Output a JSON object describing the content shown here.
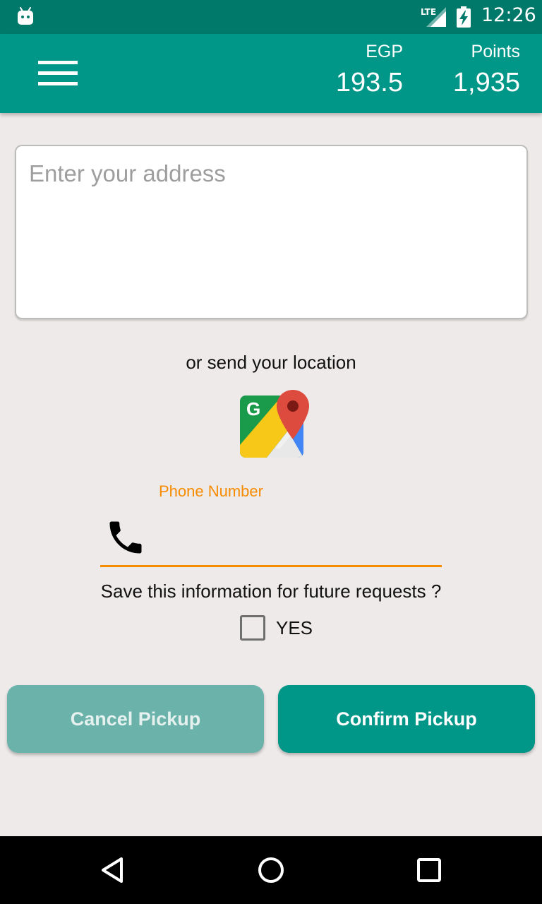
{
  "status_bar": {
    "time": "12:26",
    "network": "LTE",
    "icons": [
      "android-icon",
      "lte-signal-icon",
      "battery-charging-icon"
    ]
  },
  "app_bar": {
    "menu_icon": "hamburger-menu-icon",
    "egp": {
      "label": "EGP",
      "value": "193.5"
    },
    "points": {
      "label": "Points",
      "value": "1,935"
    },
    "color": "#009688"
  },
  "address": {
    "placeholder": "Enter your address",
    "value": ""
  },
  "location": {
    "text": "or send your location",
    "icon": "google-maps-icon"
  },
  "phone": {
    "label": "Phone Number",
    "value": "",
    "icon": "phone-icon",
    "accent_color": "#f78b00"
  },
  "save": {
    "question": "Save this information for future requests ?",
    "yes_label": "YES",
    "checked": false
  },
  "buttons": {
    "cancel_label": "Cancel Pickup",
    "confirm_label": "Confirm Pickup"
  },
  "nav_bar": {
    "icons": [
      "back-icon",
      "home-icon",
      "recents-icon"
    ]
  }
}
